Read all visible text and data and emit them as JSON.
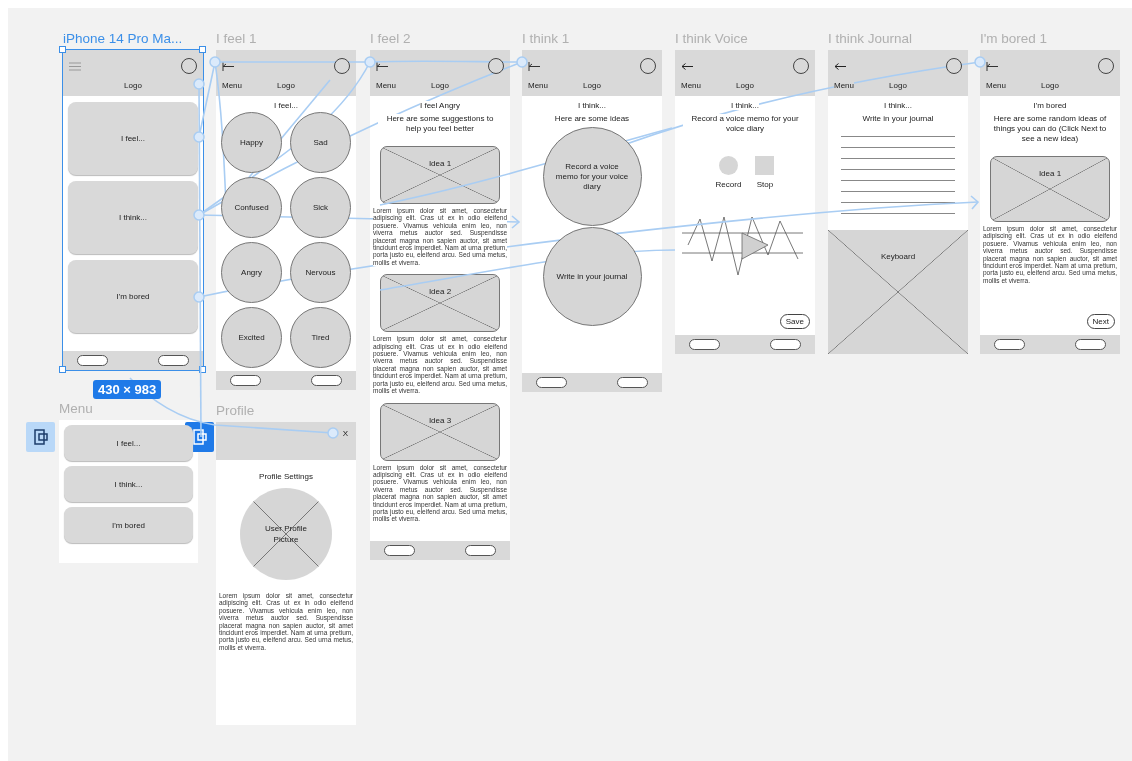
{
  "frames": [
    {
      "kind": "home",
      "title": "iPhone 14 Pro Ma...",
      "selected": true,
      "header": {
        "nav_icon": {
          "kind": "hamburger"
        },
        "logo": "Logo"
      },
      "buttons": [
        "I feel...",
        "I think...",
        "I'm bored"
      ],
      "footer": true
    },
    {
      "kind": "emotions",
      "title": "I feel 1",
      "selected": false,
      "header": {
        "nav_icon": {
          "kind": "back"
        },
        "menu_label": "Menu",
        "logo": "Logo"
      },
      "heading": "I feel...",
      "options": [
        "Happy",
        "Sad",
        "Confused",
        "Sick",
        "Angry",
        "Nervous",
        "Excited",
        "Tired"
      ],
      "footer": true
    },
    {
      "kind": "suggestions",
      "title": "I feel 2",
      "selected": false,
      "header": {
        "nav_icon": {
          "kind": "back"
        },
        "menu_label": "Menu",
        "logo": "Logo"
      },
      "heading": "I feel Angry",
      "subheading": "Here are some suggestions to help you feel better",
      "ideas": [
        {
          "label": "Idea 1",
          "text": "Lorem ipsum dolor sit amet, consectetur adipiscing elit. Cras ut ex in odio eleifend posuere. Vivamus vehicula enim leo, non viverra metus auctor sed. Suspendisse placerat magna non sapien auctor, sit amet tincidunt eros imperdiet. Nam at urna pretium, porta justo eu, eleifend arcu. Sed urna metus, mollis et viverra."
        },
        {
          "label": "Idea 2",
          "text": "Lorem ipsum dolor sit amet, consectetur adipiscing elit. Cras ut ex in odio eleifend posuere. Vivamus vehicula enim leo, non viverra metus auctor sed. Suspendisse placerat magna non sapien auctor, sit amet tincidunt eros imperdiet. Nam at urna pretium, porta justo eu, eleifend arcu. Sed urna metus, mollis et viverra."
        },
        {
          "label": "Idea 3",
          "text": "Lorem ipsum dolor sit amet, consectetur adipiscing elit. Cras ut ex in odio eleifend posuere. Vivamus vehicula enim leo, non viverra metus auctor sed. Suspendisse placerat magna non sapien auctor, sit amet tincidunt eros imperdiet. Nam at urna pretium, porta justo eu, eleifend arcu. Sed urna metus, mollis et viverra."
        }
      ],
      "footer": true
    },
    {
      "kind": "ideas",
      "title": "I think 1",
      "selected": false,
      "header": {
        "nav_icon": {
          "kind": "back"
        },
        "menu_label": "Menu",
        "logo": "Logo"
      },
      "heading": "I think...",
      "subheading": "Here are some ideas",
      "options": [
        "Record a voice memo for your voice diary",
        "Write in your journal"
      ],
      "footer": true
    },
    {
      "kind": "voice",
      "title": "I think Voice",
      "selected": false,
      "header": {
        "nav_icon": {
          "kind": "arrow"
        },
        "menu_label": "Menu",
        "logo": "Logo"
      },
      "heading": "I think...",
      "subheading": "Record a voice memo for your voice diary",
      "controls": [
        {
          "kind": "record",
          "label": "Record"
        },
        {
          "kind": "stop",
          "label": "Stop"
        }
      ],
      "action": "Save",
      "footer": true
    },
    {
      "kind": "journal",
      "title": "I think Journal",
      "selected": false,
      "header": {
        "nav_icon": {
          "kind": "arrow"
        },
        "menu_label": "Menu",
        "logo": "Logo"
      },
      "heading": "I think...",
      "subheading": "Write in your journal",
      "keyboard": "Keyboard"
    },
    {
      "kind": "bored",
      "title": "I'm bored 1",
      "selected": false,
      "header": {
        "nav_icon": {
          "kind": "back"
        },
        "menu_label": "Menu",
        "logo": "Logo"
      },
      "heading": "I'm bored",
      "subheading": "Here are some random ideas of things you can do (Click Next to see a new idea)",
      "ideas": [
        {
          "label": "Idea 1",
          "text": "Lorem ipsum dolor sit amet, consectetur adipiscing elit. Cras ut ex in odio eleifend posuere. Vivamus vehicula enim leo, non viverra metus auctor sed. Suspendisse placerat magna non sapien auctor, sit amet tincidunt eros imperdiet. Nam at urna pretium, porta justo eu, eleifend arcu. Sed urna metus, mollis et viverra."
        }
      ],
      "action": "Next",
      "footer": true
    },
    {
      "kind": "menu",
      "title": "Menu",
      "selected": false,
      "flow_marker": {
        "selected": false
      },
      "buttons": [
        "I feel...",
        "I think...",
        "I'm bored"
      ]
    },
    {
      "kind": "profile",
      "title": "Profile",
      "selected": false,
      "flow_marker": {
        "selected": true
      },
      "close": "X",
      "heading": "Profile Settings",
      "picture": "User Profile Picture",
      "text": "Lorem ipsum dolor sit amet, consectetur adipiscing elit. Cras ut ex in odio eleifend posuere. Vivamus vehicula enim leo, non viverra metus auctor sed. Suspendisse placerat magna non sapien auctor, sit amet tincidunt eros imperdiet. Nam at urna pretium, porta justo eu, eleifend arcu. Sed urna metus, mollis et viverra."
    }
  ],
  "selection_size": "430 × 983"
}
